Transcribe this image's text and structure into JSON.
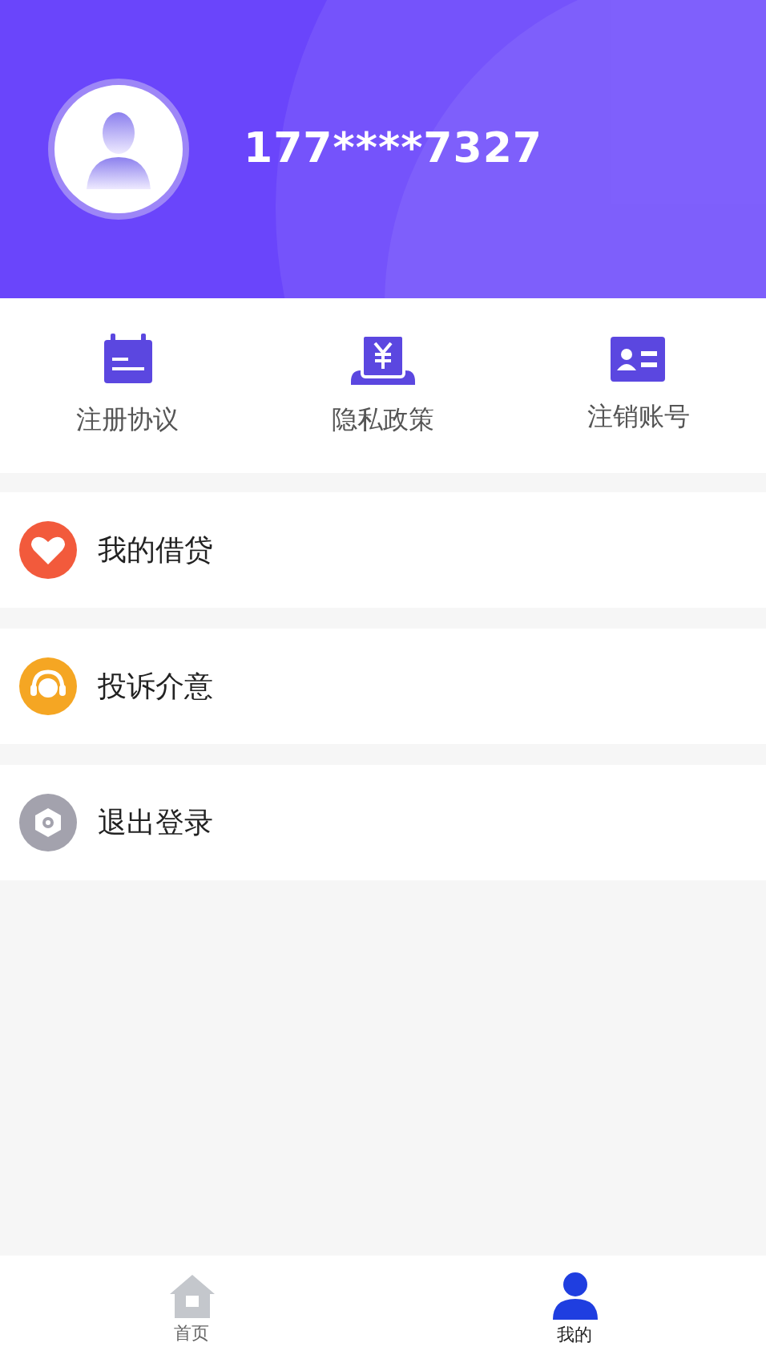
{
  "profile": {
    "phone": "177****7327"
  },
  "quick_links": [
    {
      "label": "注册协议",
      "kind": "calendar"
    },
    {
      "label": "隐私政策",
      "kind": "money"
    },
    {
      "label": "注销账号",
      "kind": "card"
    }
  ],
  "menu": [
    {
      "label": "我的借贷",
      "kind": "heart",
      "color": "#f25a3c"
    },
    {
      "label": "投诉介意",
      "kind": "headset",
      "color": "#f5a623"
    },
    {
      "label": "退出登录",
      "kind": "gear",
      "color": "#a3a2ad"
    }
  ],
  "tab_bar": [
    {
      "label": "首页",
      "kind": "home",
      "selected": false
    },
    {
      "label": "我的",
      "kind": "person",
      "selected": true
    }
  ]
}
